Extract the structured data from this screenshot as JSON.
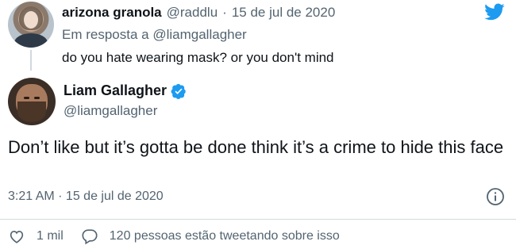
{
  "reply": {
    "name": "arizona granola",
    "handle": "@raddlu",
    "separator": "·",
    "date": "15 de jul de 2020",
    "reply_prefix": "Em resposta a",
    "reply_mention": "@liamgallagher",
    "text": "do you hate wearing mask? or you don't mind"
  },
  "tweet": {
    "name": "Liam Gallagher",
    "handle": "@liamgallagher",
    "text": "Don’t like but it’s gotta be done think it’s a crime to hide this face",
    "timestamp": "3:21 AM · 15 de jul de 2020"
  },
  "actions": {
    "likes": "1 mil",
    "conversation": "120 pessoas estão tweetando sobre isso"
  },
  "colors": {
    "brand": "#1d9bf0",
    "text": "#0f1419",
    "muted": "#536471",
    "border": "#cfd9de"
  },
  "icons": {
    "brand": "twitter-bird-icon",
    "verified": "verified-badge-icon",
    "info": "info-icon",
    "like": "heart-icon",
    "reply": "speech-bubble-icon"
  }
}
